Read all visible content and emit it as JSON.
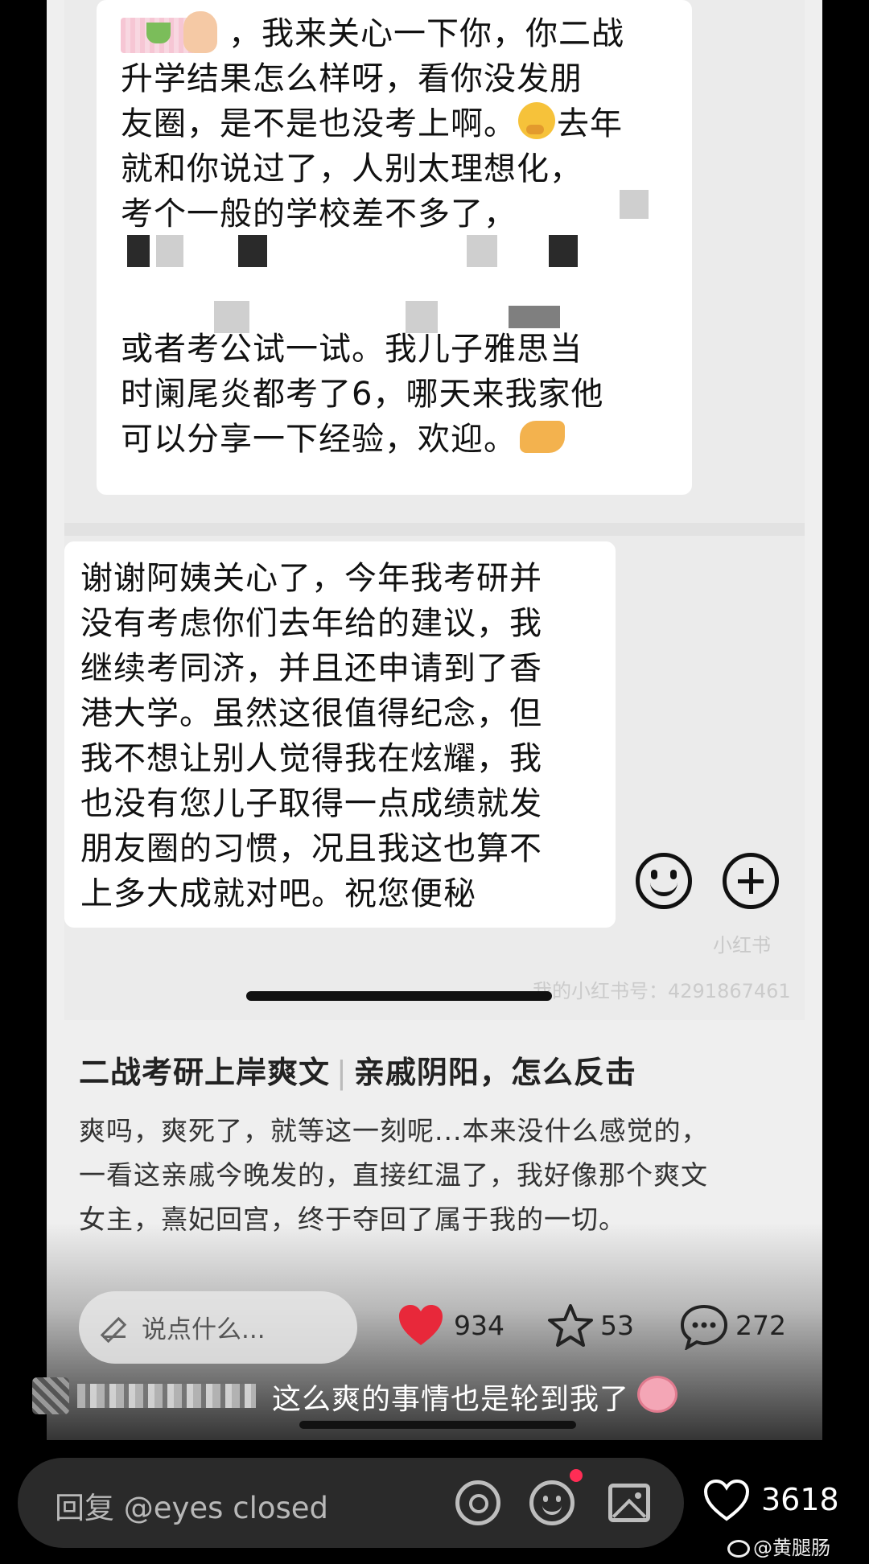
{
  "chat": {
    "left_bubble_lines": [
      "，我来关心一下你，你二战",
      "升学结果怎么样呀，看你没发朋",
      "友圈，是不是也没考上啊。",
      "去年",
      "就和你说过了，人别太理想化，",
      "考个一般的学校差不多了，",
      "或者考公试一试。我儿子雅思当",
      "时阑尾炎都考了6，哪天来我家他",
      "可以分享一下经验，欢迎。"
    ],
    "right_bubble_lines": [
      "谢谢阿姨关心了，今年我考研并",
      "没有考虑你们去年给的建议，我",
      "继续考同济，并且还申请到了香",
      "港大学。虽然这很值得纪念，但",
      "我不想让别人觉得我在炫耀，我",
      "也没有您儿子取得一点成绩就发",
      "朋友圈的习惯，况且我这也算不",
      "上多大成就对吧。祝您便秘"
    ],
    "watermark_logo": "小红书",
    "watermark_id": "我的小红书号：4291867461"
  },
  "post": {
    "title_left": "二战考研上岸爽文",
    "title_sep": "|",
    "title_right": "亲戚阴阳，怎么反击",
    "body": [
      "爽吗，爽死了，就等这一刻呢...本来没什么感觉的，",
      "一看这亲戚今晚发的，直接红温了，我好像那个爽文",
      "女主，熹妃回宫，终于夺回了属于我的一切。"
    ]
  },
  "inner_bar": {
    "comment_placeholder": "说点什么...",
    "likes": "934",
    "stars": "53",
    "comments": "272"
  },
  "overlay_comment": {
    "text": "这么爽的事情也是轮到我了"
  },
  "reply_bar": {
    "placeholder": "回复 @eyes closed",
    "like_count": "3618"
  },
  "watermark": {
    "weibo_handle": "@黄腿肠"
  },
  "colors": {
    "like_red": "#e8283a",
    "notification_red": "#ff2d55",
    "reply_bar_bg": "#2a2a2a"
  }
}
